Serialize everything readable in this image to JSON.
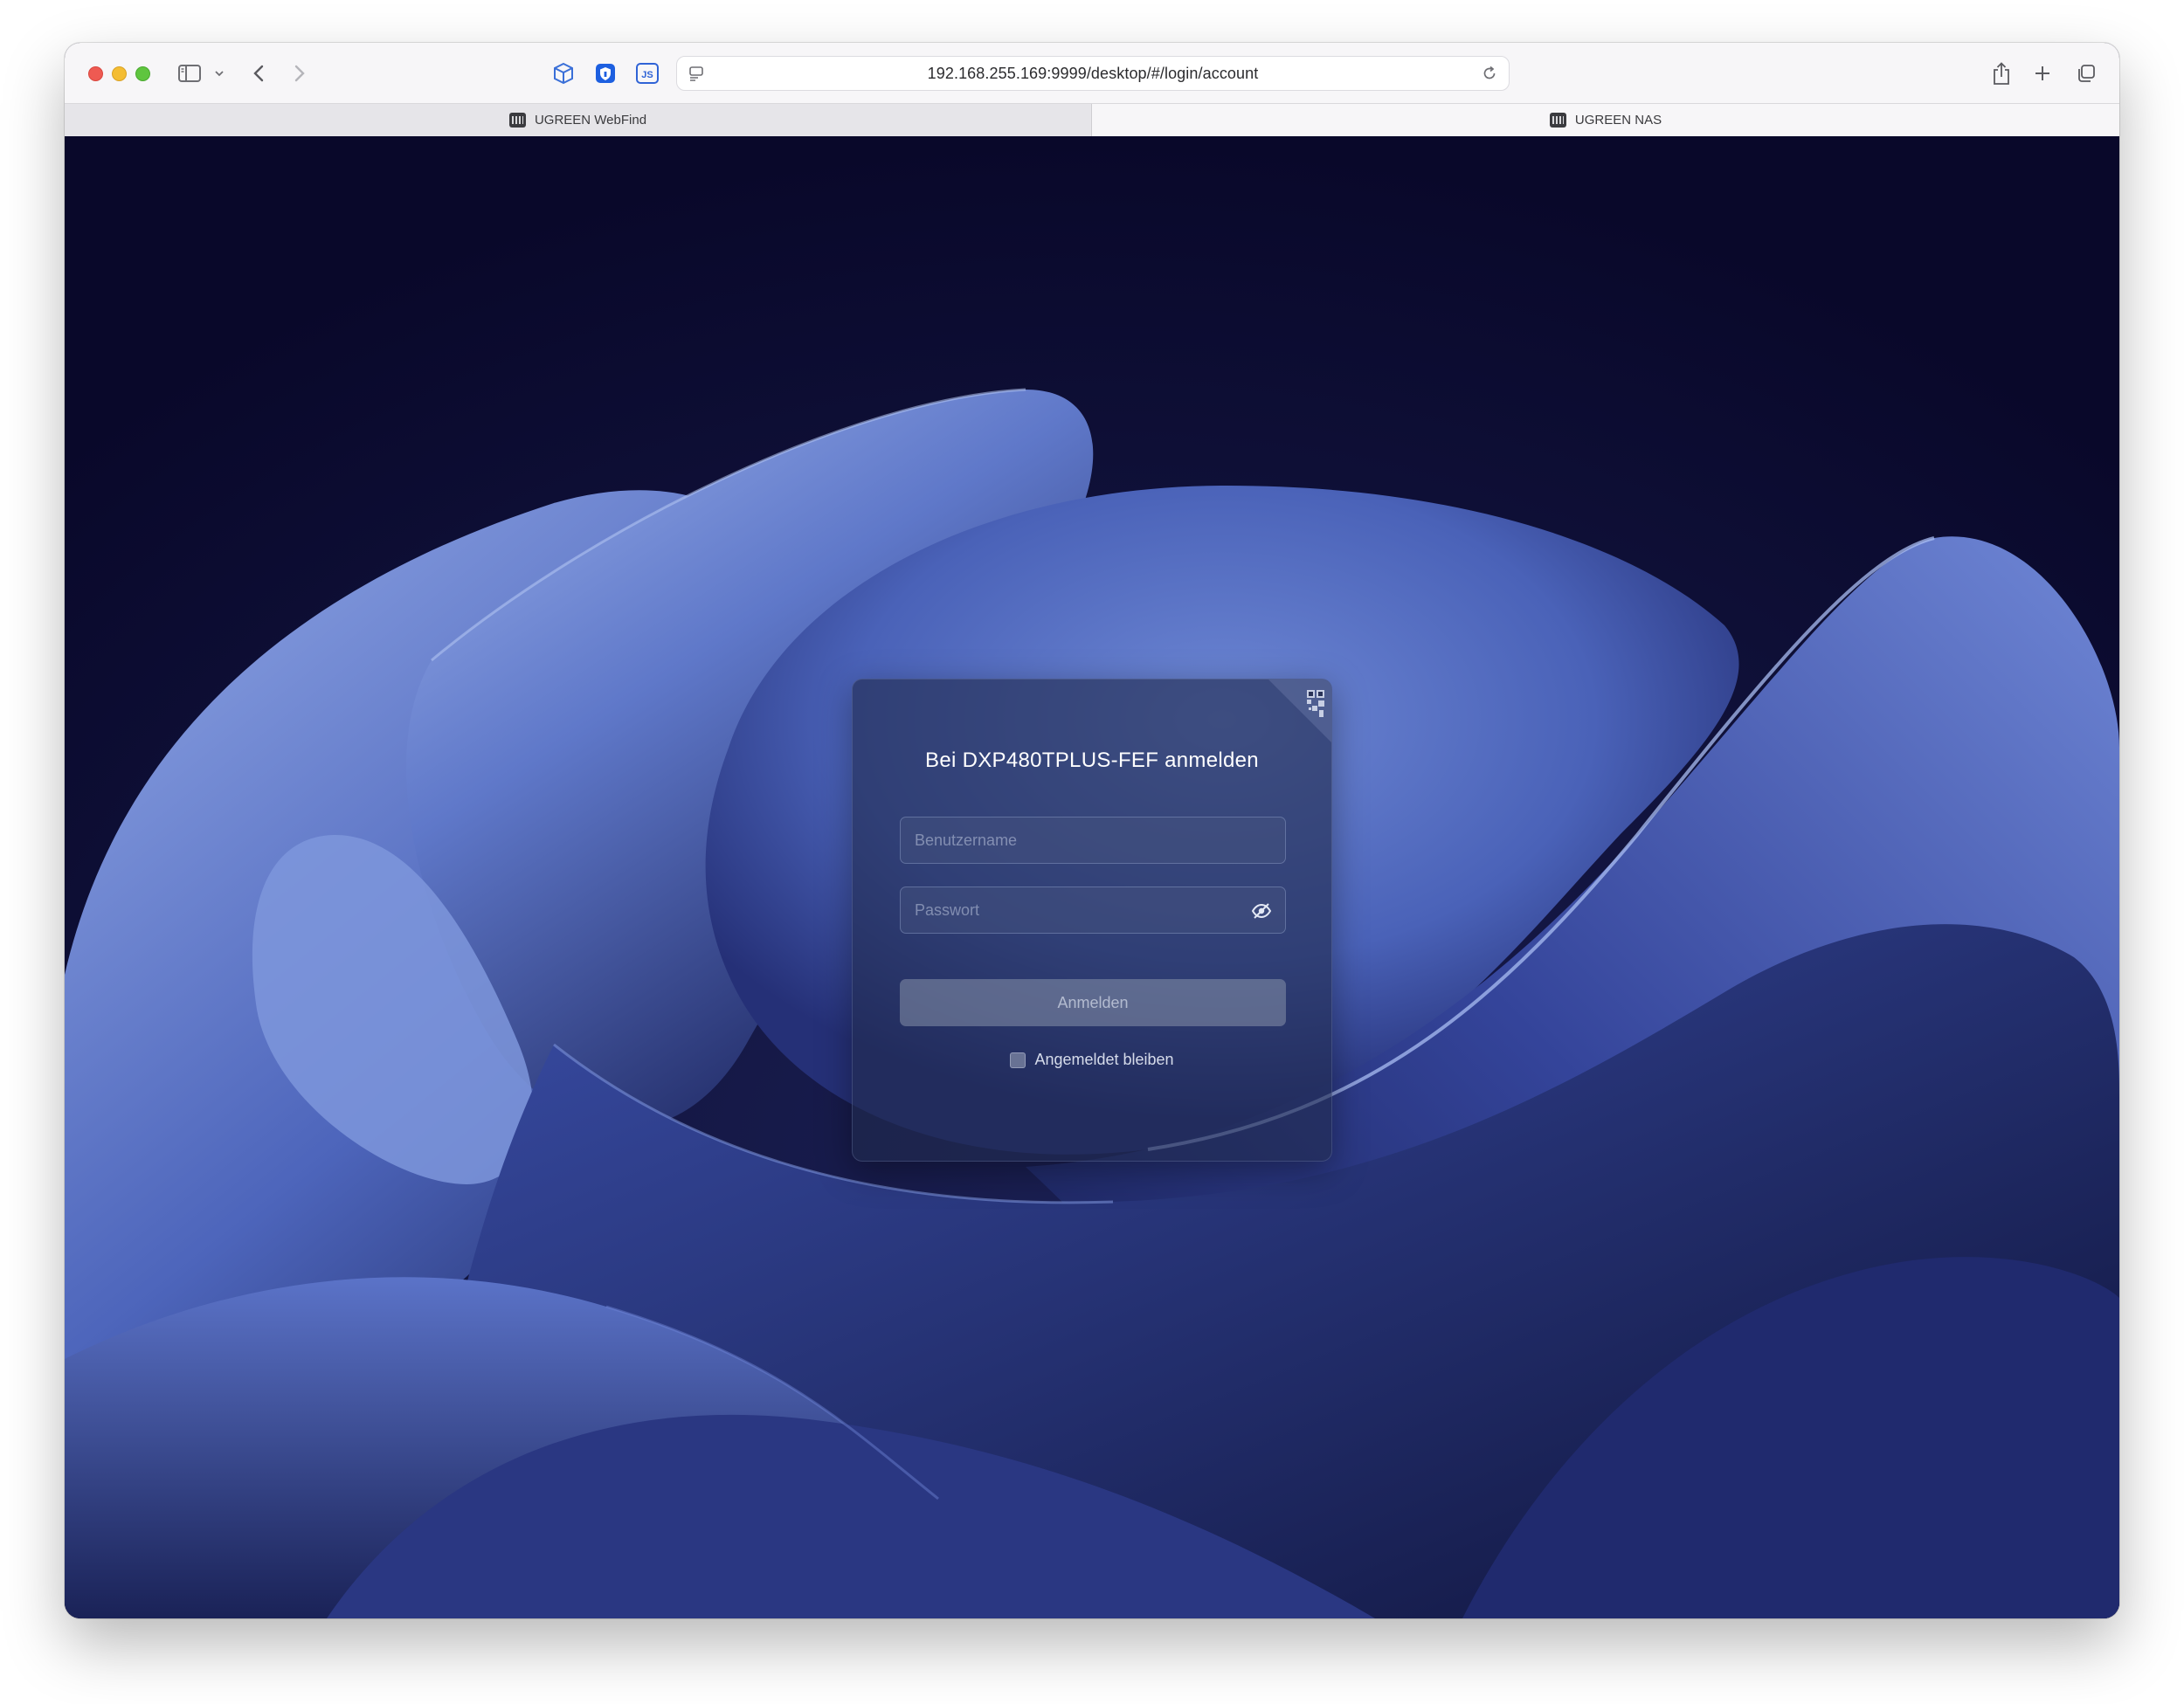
{
  "browser": {
    "url": "192.168.255.169:9999/desktop/#/login/account",
    "tabs": [
      {
        "label": "UGREEN WebFind",
        "active": false
      },
      {
        "label": "UGREEN NAS",
        "active": true
      }
    ],
    "extensions": [
      "box-icon",
      "shield-icon",
      "js-icon"
    ]
  },
  "login": {
    "title": "Bei DXP480TPLUS-FEF anmelden",
    "username_placeholder": "Benutzername",
    "username_value": "",
    "password_placeholder": "Passwort",
    "password_value": "",
    "submit_label": "Anmelden",
    "remember_label": "Angemeldet bleiben",
    "remember_checked": false
  },
  "colors": {
    "background": "#0b0a2c",
    "wave_light": "#8fa6e3",
    "wave_dark": "#1c2352",
    "card": "#212a4e"
  }
}
